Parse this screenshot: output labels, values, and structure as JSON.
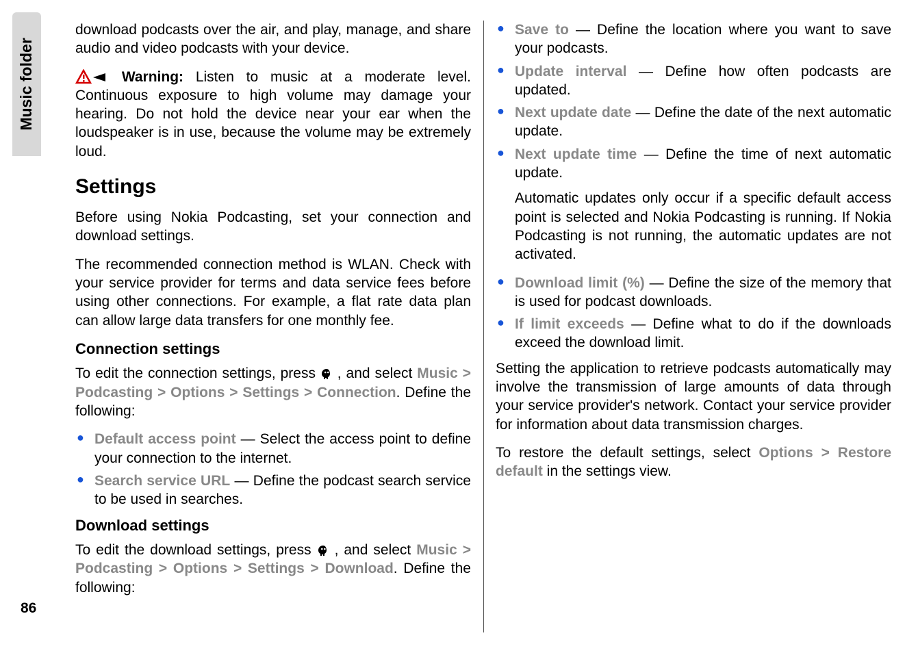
{
  "sidebar": {
    "label": "Music folder"
  },
  "pageNumber": "86",
  "col1": {
    "intro": "download podcasts over the air, and play, manage, and share audio and video podcasts with your device.",
    "warningLabel": "Warning:",
    "warningText": "  Listen to music at a moderate level. Continuous exposure to high volume may damage your hearing. Do not hold the device near your ear when the loudspeaker is in use, because the volume may be extremely loud.",
    "settingsHeading": "Settings",
    "settingsP1": "Before using Nokia Podcasting, set your connection and download settings.",
    "settingsP2": "The recommended connection method is WLAN. Check with your service provider for terms and data service fees before using other connections. For example, a flat rate data plan can allow large data transfers for one monthly fee.",
    "connHeading": "Connection settings",
    "connIntro1": "To edit the connection settings, press ",
    "connIntro2": " , and select ",
    "connNav": {
      "a": "Music",
      "b": "Podcasting",
      "c": "Options",
      "d": "Settings",
      "e": "Connection"
    },
    "connIntro3": ". Define the following:",
    "connItems": [
      {
        "label": "Default access point",
        "text": " — Select the access point to define your connection to the internet."
      },
      {
        "label": "Search service URL",
        "text": " — Define the podcast search service to be used in searches."
      }
    ],
    "dlHeading": "Download settings"
  },
  "col2": {
    "dlIntro1": "To edit the download settings, press ",
    "dlIntro2": " , and select ",
    "dlNav": {
      "a": "Music",
      "b": "Podcasting",
      "c": "Options",
      "d": "Settings",
      "e": "Download"
    },
    "dlIntro3": ". Define the following:",
    "dlItems": [
      {
        "label": "Save to",
        "text": " — Define the location where you want to save your podcasts."
      },
      {
        "label": "Update interval",
        "text": " — Define how often podcasts are updated."
      },
      {
        "label": "Next update date",
        "text": " — Define the date of the next automatic update."
      },
      {
        "label": "Next update time",
        "text": " — Define the time of next automatic update."
      }
    ],
    "autoNote": "Automatic updates only occur if a specific default access point is selected and Nokia Podcasting is running. If Nokia Podcasting is not running, the automatic updates are not activated.",
    "dlItems2": [
      {
        "label": "Download limit (%)",
        "text": " — Define the size of the memory that is used for podcast downloads."
      },
      {
        "label": "If limit exceeds",
        "text": " — Define what to do if the downloads exceed the download limit."
      }
    ],
    "autoWarn": "Setting the application to retrieve podcasts automatically may involve the transmission of large amounts of data through your service provider's network. Contact your service provider for information about data transmission charges.",
    "restore1": "To restore the default settings, select ",
    "restoreNav": {
      "a": "Options",
      "b": "Restore default"
    },
    "restore2": " in the settings view."
  }
}
